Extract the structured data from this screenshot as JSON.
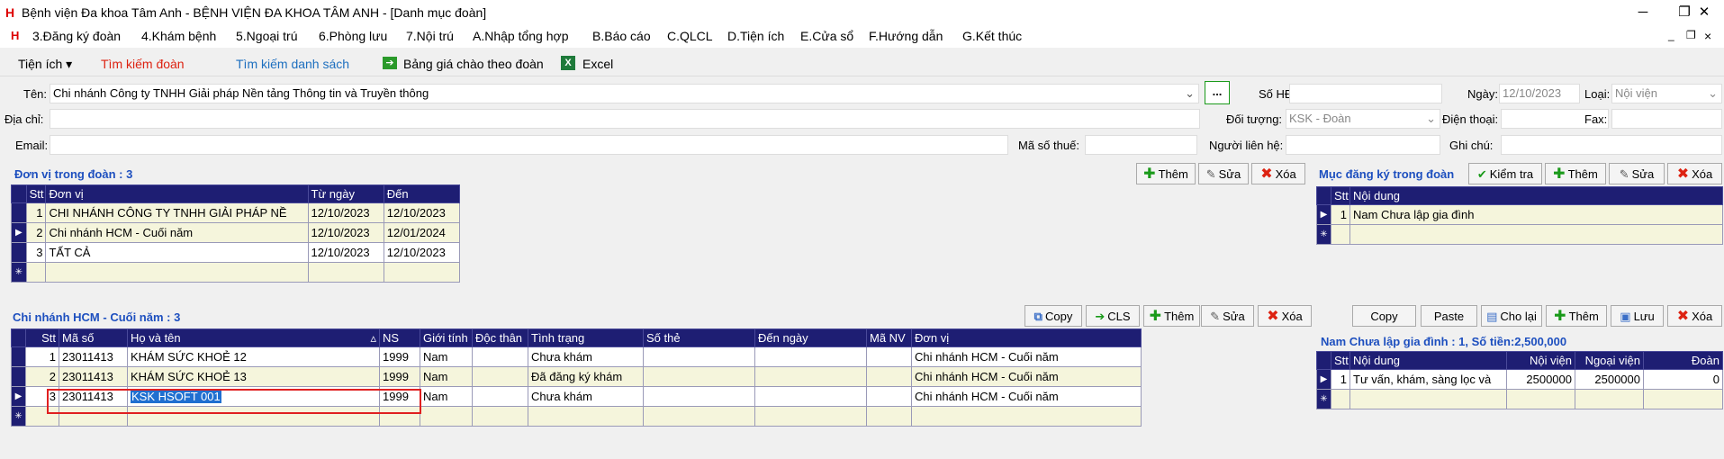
{
  "window": {
    "app_icon": "H",
    "title": "Bệnh viện Đa khoa Tâm Anh - BỆNH VIỆN ĐA KHOA TÂM ANH - [Danh mục đoàn]",
    "controls": [
      "─",
      "❐",
      "✕"
    ]
  },
  "menu": {
    "logo": "H",
    "items": [
      "3.Đăng ký đoàn",
      "4.Khám bệnh",
      "5.Ngoại trú",
      "6.Phòng lưu",
      "7.Nội trú",
      "A.Nhập tổng hợp",
      "B.Báo cáo",
      "C.QLCL",
      "D.Tiện ích",
      "E.Cửa sổ",
      "F.Hướng dẫn",
      "G.Kết thúc"
    ],
    "mdi_controls": [
      "_",
      "❐",
      "×"
    ]
  },
  "toolbar": {
    "utilities": "Tiện ích ▾",
    "search_group": "Tìm kiếm đoàn",
    "search_list": "Tìm kiếm danh sách",
    "price_list": "Bảng giá chào theo đoàn",
    "excel": "Excel"
  },
  "form": {
    "name_label": "Tên:",
    "name_value": "Chi nhánh Công ty TNHH Giải pháp Nền tảng Thông tin và Truyền thông",
    "dots_button": "...",
    "contract_label": "Số HĐ:",
    "contract_value": "",
    "date_label": "Ngày:",
    "date_value": "12/10/2023",
    "type_label": "Loại:",
    "type_value": "Nội viện",
    "address_label": "Địa chỉ:",
    "target_label": "Đối tượng:",
    "target_value": "KSK - Đoàn",
    "phone_label": "Điện thoại:",
    "fax_label": "Fax:",
    "email_label": "Email:",
    "tax_label": "Mã số thuế:",
    "contact_label": "Người liên hệ:",
    "note_label": "Ghi chú:"
  },
  "units": {
    "title": "Đơn vị trong đoàn : 3",
    "buttons": [
      "Thêm",
      "Sửa",
      "Xóa"
    ],
    "columns": [
      "Stt",
      "Đơn vị",
      "Từ ngày",
      "Đến"
    ],
    "rows": [
      [
        "1",
        "CHI NHÁNH CÔNG TY TNHH GIẢI PHÁP NỀ",
        "12/10/2023",
        "12/10/2023"
      ],
      [
        "2",
        "Chi nhánh HCM - Cuối năm",
        "12/10/2023",
        "12/01/2024"
      ],
      [
        "3",
        "TẤT CẢ",
        "12/10/2023",
        "12/10/2023"
      ]
    ],
    "new_row_marker": "✳"
  },
  "registrations": {
    "title": "Mục đăng ký trong đoàn",
    "buttons": [
      "Kiểm tra",
      "Thêm",
      "Sửa",
      "Xóa"
    ],
    "columns": [
      "Stt",
      "Nội dung"
    ],
    "rows": [
      [
        "1",
        "Nam Chưa lập gia đình"
      ]
    ],
    "new_row_marker": "✳"
  },
  "members": {
    "title": "Chi nhánh HCM - Cuối năm : 3",
    "buttons": [
      "Copy",
      "CLS",
      "Thêm",
      "Sửa",
      "Xóa"
    ],
    "columns": [
      "Stt",
      "Mã số",
      "Họ và tên",
      "NS",
      "Giới tính",
      "Độc thân",
      "Tình trạng",
      "Số thẻ",
      "Đến ngày",
      "Mã NV",
      "Đơn vị"
    ],
    "sort_indicator": "▵",
    "rows": [
      [
        "1",
        "23011413",
        "KHÁM SỨC KHOẺ 12",
        "1999",
        "Nam",
        "",
        "Chưa khám",
        "",
        "",
        "",
        "Chi nhánh HCM - Cuối năm"
      ],
      [
        "2",
        "23011413",
        "KHÁM SỨC KHOẺ 13",
        "1999",
        "Nam",
        "",
        "Đã đăng ký khám",
        "",
        "",
        "",
        "Chi nhánh HCM - Cuối năm"
      ],
      [
        "3",
        "23011413",
        "KSK HSOFT 001",
        "1999",
        "Nam",
        "",
        "Chưa khám",
        "",
        "",
        "",
        "Chi nhánh HCM - Cuối năm"
      ]
    ],
    "new_row_marker": "✳"
  },
  "services": {
    "buttons": [
      "Copy",
      "Paste",
      "Cho lại",
      "Thêm",
      "Lưu",
      "Xóa"
    ],
    "title": "Nam Chưa lập gia đình : 1, Số tiền:2,500,000",
    "columns": [
      "Stt",
      "Nội dung",
      "Nội viện",
      "Ngoại viện",
      "Đoàn"
    ],
    "rows": [
      [
        "1",
        "Tư vấn, khám, sàng lọc và",
        "2500000",
        "2500000",
        "0"
      ]
    ],
    "new_row_marker": "✳"
  },
  "colors": {
    "grid_header": "#1e1e73",
    "row_alt": "#f5f5dc",
    "section_title": "#1d4fbf",
    "highlight_box": "#e02020"
  }
}
